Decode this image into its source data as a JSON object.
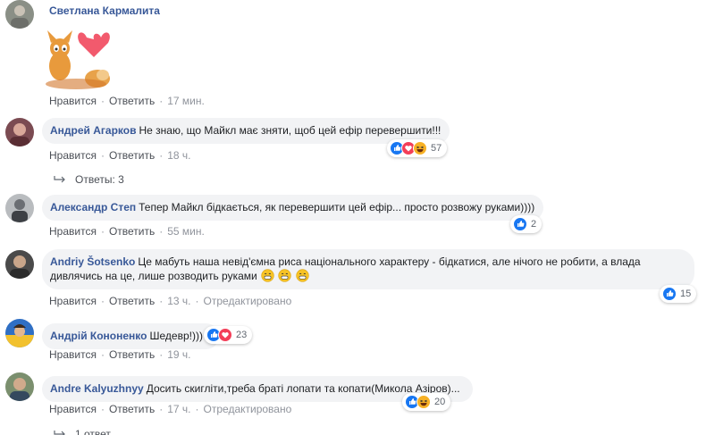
{
  "comments": [
    {
      "author": "Светлана Кармалита",
      "text": "",
      "sticker": "cat-dog-heart-sticker",
      "actions": {
        "like": "Нравится",
        "reply": "Ответить",
        "time": "17 мин."
      }
    },
    {
      "author": "Андрей Агарков",
      "text": "Не знаю, що Майкл має зняти, щоб цей ефір перевершити!!!",
      "actions": {
        "like": "Нравится",
        "reply": "Ответить",
        "time": "18 ч."
      },
      "reaction_count": "57",
      "reaction_icons": [
        "like-icon",
        "love-icon",
        "haha-icon"
      ],
      "replies_label": "Ответы: 3"
    },
    {
      "author": "Александр Степ",
      "text": "Тепер Майкл бідкається, як перевершити цей ефір... просто розвожу руками))))",
      "actions": {
        "like": "Нравится",
        "reply": "Ответить",
        "time": "55 мин."
      },
      "reaction_count": "2",
      "reaction_icons": [
        "like-icon"
      ]
    },
    {
      "author": "Andriy Šotsenko",
      "text_line1": "Це мабуть наша невід'ємна риса національного характеру - бідкатися, але нічого не робити, а влада",
      "text_line2": "дивлячись на це, лише розводить руками",
      "inline_emoji": [
        "grin-emoji",
        "grin-emoji",
        "grin-emoji"
      ],
      "actions": {
        "like": "Нравится",
        "reply": "Ответить",
        "time": "13 ч.",
        "edited": "Отредактировано"
      },
      "reaction_count": "15",
      "reaction_icons": [
        "like-icon"
      ]
    },
    {
      "author": "Андрій Кононенко",
      "text": "Шедевр!)))",
      "actions": {
        "like": "Нравится",
        "reply": "Ответить",
        "time": "19 ч."
      },
      "reaction_count": "23",
      "reaction_icons": [
        "like-icon",
        "love-icon"
      ]
    },
    {
      "author": "Andre Kalyuzhnyy",
      "text": "Досить скиглiти,треба братi лопати та копати(Микола Азiров)...",
      "actions": {
        "like": "Нравится",
        "reply": "Ответить",
        "time": "17 ч.",
        "edited": "Отредактировано"
      },
      "reaction_count": "20",
      "reaction_icons": [
        "like-icon",
        "haha-icon"
      ]
    }
  ],
  "footer": {
    "replies_label": "1 ответ"
  },
  "colors": {
    "author": "#385898",
    "bubble": "#f2f3f5",
    "meta": "#90949c",
    "like": "#1877f2",
    "love": "#f33e58",
    "haha": "#f7b125"
  }
}
